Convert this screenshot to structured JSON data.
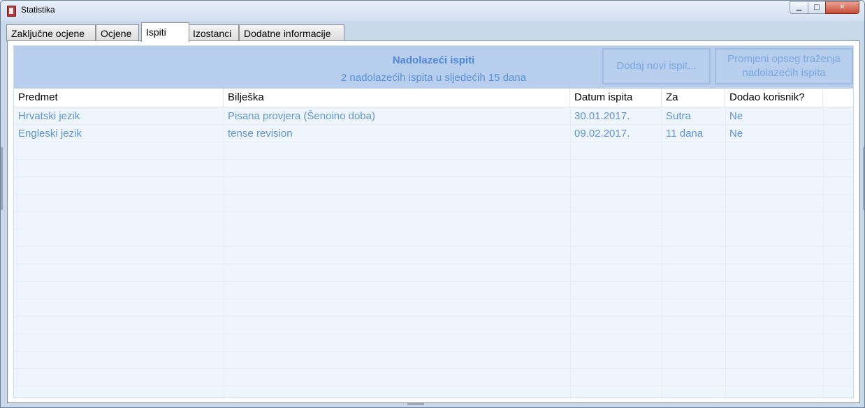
{
  "window": {
    "title": "Statistika",
    "minimize": "▁",
    "maximize": "□",
    "close": "✕"
  },
  "tabs": [
    {
      "label": "Zaključne ocjene"
    },
    {
      "label": "Ocjene"
    },
    {
      "label": "Ispiti",
      "active": true
    },
    {
      "label": "Izostanci"
    },
    {
      "label": "Dodatne informacije"
    }
  ],
  "header": {
    "title": "Nadolazeći ispiti",
    "subtitle": "2 nadolazećih ispita u sljedećih 15 dana",
    "add_button": "Dodaj novi ispit...",
    "range_button_line1": "Promjeni opseg traženja",
    "range_button_line2": "nadolazećih ispita"
  },
  "table": {
    "columns": [
      "Predmet",
      "Bilješka",
      "Datum ispita",
      "Za",
      "Dodao korisnik?"
    ],
    "rows": [
      [
        "Hrvatski jezik",
        "Pisana provjera (Šenoino doba)",
        "30.01.2017.",
        "Sutra",
        "Ne"
      ],
      [
        "Engleski jezik",
        "tense revision",
        "09.02.2017.",
        "11 dana",
        "Ne"
      ]
    ]
  },
  "colors": {
    "accent": "#4f86d6",
    "row_text": "#5f93da",
    "header_bg": "#b7cfed"
  }
}
